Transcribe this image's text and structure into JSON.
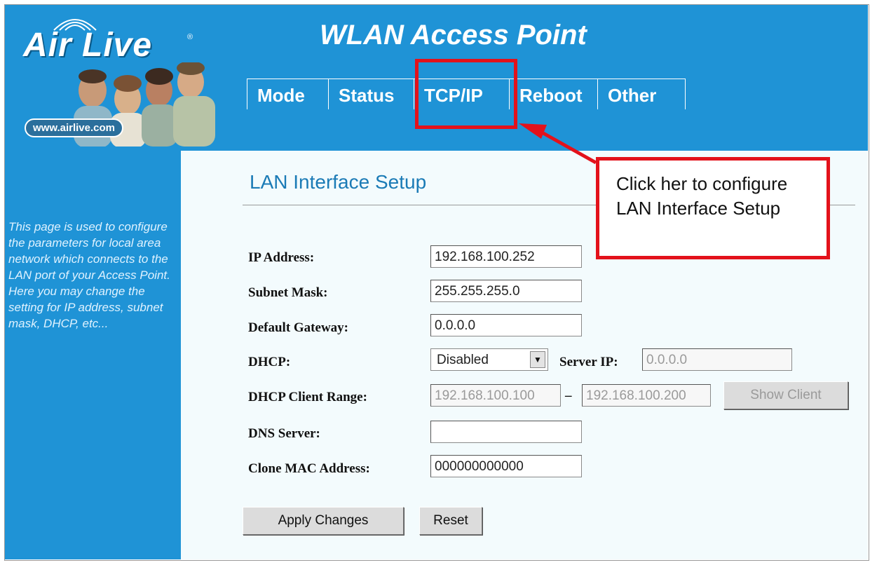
{
  "brand": {
    "logo": "Air Live",
    "registered": "®",
    "url": "www.airlive.com"
  },
  "app_title": "WLAN Access Point",
  "tabs": [
    {
      "label": "Mode"
    },
    {
      "label": "Status"
    },
    {
      "label": "TCP/IP",
      "active": true
    },
    {
      "label": "Reboot"
    },
    {
      "label": "Other"
    }
  ],
  "sidebar": {
    "description": "This page is used to configure the parameters for local area network which connects to the LAN port of your Access Point. Here you may change the setting for IP address, subnet mask, DHCP, etc..."
  },
  "section_title": "LAN Interface Setup",
  "form": {
    "ip_address": {
      "label": "IP Address:",
      "value": "192.168.100.252"
    },
    "subnet_mask": {
      "label": "Subnet Mask:",
      "value": "255.255.255.0"
    },
    "default_gateway": {
      "label": "Default Gateway:",
      "value": "0.0.0.0"
    },
    "dhcp": {
      "label": "DHCP:",
      "selected": "Disabled",
      "server_ip_label": "Server IP:",
      "server_ip_value": "0.0.0.0"
    },
    "dhcp_client_range": {
      "label": "DHCP Client Range:",
      "start": "192.168.100.100",
      "separator": "–",
      "end": "192.168.100.200",
      "show_client_label": "Show Client"
    },
    "dns_server": {
      "label": "DNS Server:",
      "value": ""
    },
    "clone_mac": {
      "label": "Clone MAC Address:",
      "value": "000000000000"
    },
    "apply_label": "Apply Changes",
    "reset_label": "Reset"
  },
  "annotation": {
    "callout_text": "Click her to configure LAN Interface Setup",
    "color": "#e3121b"
  },
  "colors": {
    "header_blue": "#1f93d6",
    "content_bg": "#f3fbfd",
    "title_blue": "#1b7bb6"
  }
}
